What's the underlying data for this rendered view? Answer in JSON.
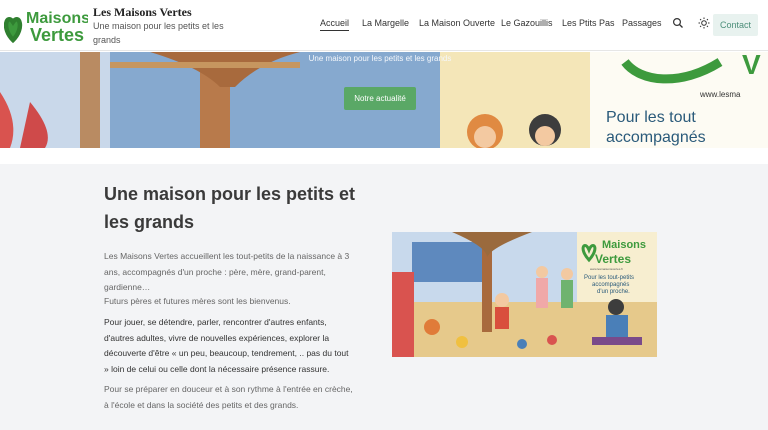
{
  "header": {
    "logo_text_line1": "Maisons",
    "logo_text_line2": "Vertes",
    "site_title": "Les Maisons Vertes",
    "tagline": "Une maison pour les petits et les grands",
    "nav": [
      "Accueil",
      "La Margelle",
      "La Maison Ouverte",
      "Le Gazouillis",
      "Les Ptits Pas",
      "Passages"
    ],
    "active_nav": "Accueil",
    "icons": [
      "search-icon",
      "sun-icon"
    ],
    "contact_label": "Contact"
  },
  "hero": {
    "subtitle": "Une maison pour les petits et les grands",
    "button_label": "Notre actualité",
    "banner_text_1": "Pour les tout",
    "banner_text_2": "accompagnés",
    "banner_url": "www.lesma"
  },
  "main": {
    "heading": "Une maison pour les petits et les grands",
    "para1": "Les Maisons Vertes accueillent les tout-petits de la naissance à 3 ans, accompagnés d'un proche : père, mère, grand-parent, gardienne…",
    "para2": "Futurs pères et futures mères sont les bienvenus.",
    "para3": "Pour jouer, se détendre, parler, rencontrer d'autres enfants, d'autres adultes, vivre de nouvelles expériences, explorer la découverte d'être « un peu, beaucoup, tendrement, .. pas du tout » loin de celui ou celle dont la nécessaire présence rassure.",
    "para4": "Pour se préparer en douceur et à son rythme à l'entrée en crèche, à l'école et dans la société des petits et des grands."
  },
  "illustration": {
    "logo_line1": "Maisons",
    "logo_line2": "Vertes",
    "small_url": "www.lesmaisonsvertes.fr",
    "caption_1": "Pour les tout-petits",
    "caption_2": "accompagnés",
    "caption_3": "d'un proche."
  },
  "colors": {
    "brand_green": "#3d9a3d",
    "button_green": "#5aa866",
    "contact_bg": "#e8f2ef",
    "content_bg": "#f3f4f6"
  }
}
